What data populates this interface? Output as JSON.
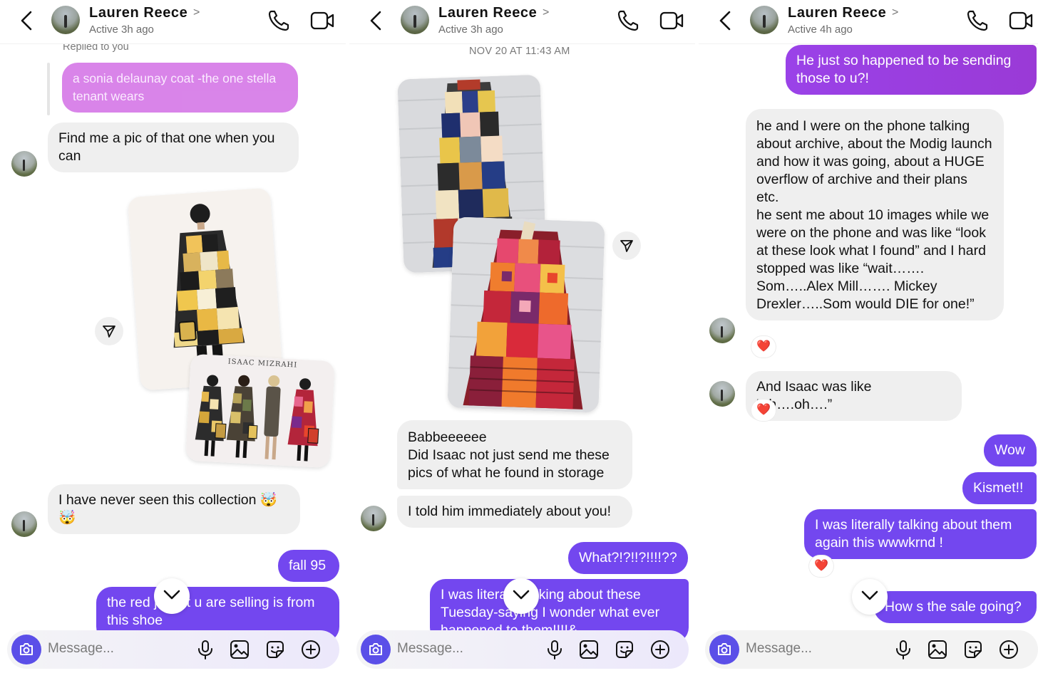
{
  "colors": {
    "outgoing": "#7347ef",
    "outgoing_alt": "#9b3fe6",
    "incoming": "#efefef",
    "reply_quote": "#d77ee8",
    "camera": "#5b4fe8",
    "heart": "#e0162b"
  },
  "icons": {
    "back": "chevron-left-icon",
    "call": "phone-icon",
    "video": "video-camera-icon",
    "share": "send-icon",
    "scroll": "chevron-down-icon",
    "camera": "camera-icon",
    "mic": "microphone-icon",
    "gallery": "image-icon",
    "sticker": "sticker-icon",
    "add": "plus-circle-icon",
    "reaction": "heart"
  },
  "panels": [
    {
      "header": {
        "name": "Lauren Reece",
        "chevron": ">",
        "status": "Active 3h ago"
      },
      "replied_label": "Replied to you",
      "quoted_message": "a sonia delaunay coat -the one stella tenant wears",
      "messages": [
        {
          "text": "Find me a pic of that one when you can"
        },
        {
          "text": "I have never seen this collection 🤯 🤯"
        },
        {
          "text": "fall 95"
        },
        {
          "text": "the red jacket u are selling is from this shoe"
        }
      ],
      "photo_caption": "ISAAC MIZRAHI",
      "composer_placeholder": "Message..."
    },
    {
      "header": {
        "name": "Lauren Reece",
        "chevron": ">",
        "status": "Active 3h ago"
      },
      "timestamp": "NOV 20 AT 11:43 AM",
      "messages": [
        {
          "text": "Babbeeeeee\nDid Isaac not just send me these pics of what he found in storage"
        },
        {
          "text": "I told him immediately about you!"
        },
        {
          "text": "What?!?!!?!!!!??"
        },
        {
          "text": "I was literally talking about these Tuesday-saying  I wonder what ever happened to them!!!!&"
        }
      ],
      "composer_placeholder": "Message..."
    },
    {
      "header": {
        "name": "Lauren Reece",
        "chevron": ">",
        "status": "Active 4h ago"
      },
      "messages": [
        {
          "text": "He just so happened to be sending those to u?!"
        },
        {
          "text": " he and I were on the phone talking about archive, about the Modig launch and how it was going, about a HUGE overflow of archive and their plans etc.\n he sent me about 10 images while we were on the phone and was like “look at these look what I found” and I hard stopped was like “wait……. Som…..Alex Mill……. Mickey Drexler…..Som would DIE for one!”"
        },
        {
          "text": "And Isaac was like “oh….oh….”"
        },
        {
          "text": "Wow"
        },
        {
          "text": "Kismet!!"
        },
        {
          "text": "I was literally talking about them again this wwwkrnd !"
        },
        {
          "text": "How s the sale going?"
        }
      ],
      "reactions": [
        "❤️",
        "❤️",
        "❤️"
      ],
      "composer_placeholder": "Message..."
    }
  ]
}
